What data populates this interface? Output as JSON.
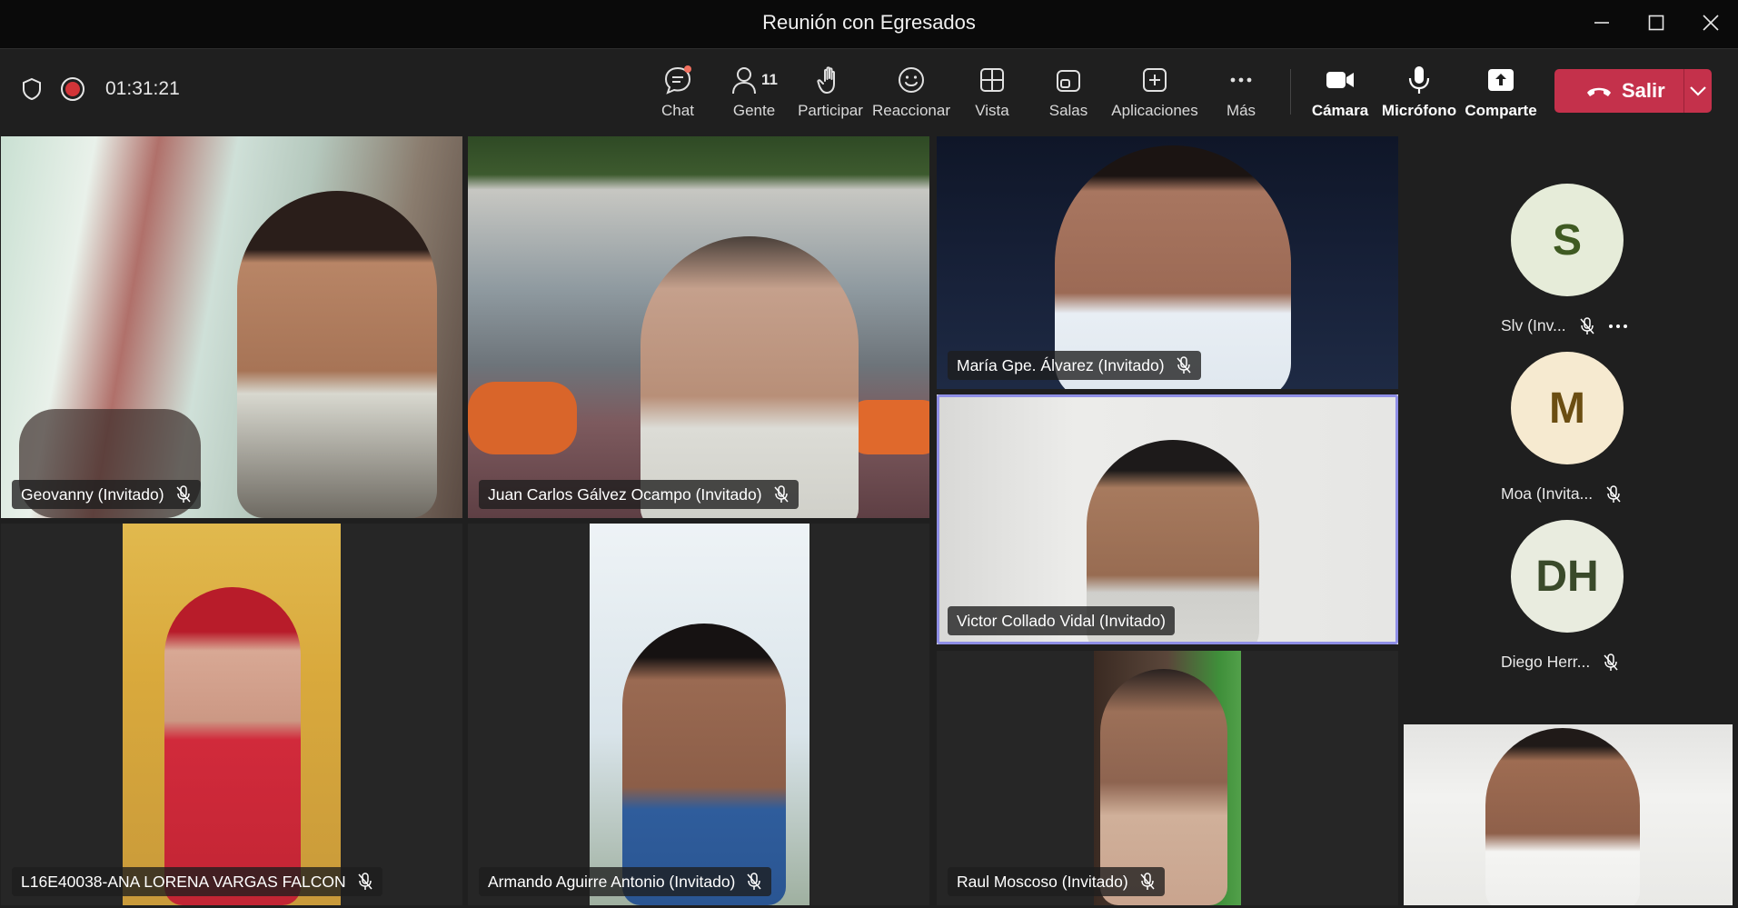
{
  "window": {
    "title": "Reunión con Egresados"
  },
  "toolbar": {
    "timer": "01:31:21",
    "buttons": [
      {
        "label": "Chat",
        "icon": "chat-icon"
      },
      {
        "label": "Gente",
        "icon": "people-icon",
        "count": "11"
      },
      {
        "label": "Participar",
        "icon": "raise-hand-icon"
      },
      {
        "label": "Reaccionar",
        "icon": "smiley-icon"
      },
      {
        "label": "Vista",
        "icon": "grid-view-icon"
      },
      {
        "label": "Salas",
        "icon": "rooms-icon"
      },
      {
        "label": "Aplicaciones",
        "icon": "add-apps-icon"
      },
      {
        "label": "Más",
        "icon": "more-icon"
      },
      {
        "label": "Cámara",
        "icon": "camera-icon"
      },
      {
        "label": "Micrófono",
        "icon": "microphone-icon"
      },
      {
        "label": "Comparte",
        "icon": "share-icon"
      }
    ],
    "leave_label": "Salir"
  },
  "participants": [
    {
      "name": "Geovanny (Invitado)"
    },
    {
      "name": "Juan Carlos Gálvez Ocampo (Invitado)"
    },
    {
      "name": "María Gpe. Álvarez (Invitado)"
    },
    {
      "name": "Victor Collado Vidal (Invitado)"
    },
    {
      "name": "L16E40038-ANA LORENA VARGAS FALCON"
    },
    {
      "name": "Armando Aguirre Antonio (Invitado)"
    },
    {
      "name": "Raul Moscoso (Invitado)"
    }
  ],
  "sidebar": [
    {
      "initials": "S",
      "name": "Slv (Inv...",
      "bg": "#e6ecd9",
      "fg": "#3f5a22"
    },
    {
      "initials": "M",
      "name": "Moa (Invita...",
      "bg": "#f6ead0",
      "fg": "#6b4e12"
    },
    {
      "initials": "DH",
      "name": "Diego Herr...",
      "bg": "#e9ecdf",
      "fg": "#3a4a2a"
    }
  ],
  "colors": {
    "accent": "#8f8fe6",
    "leave": "#c4314b",
    "notification": "#f2705f"
  }
}
